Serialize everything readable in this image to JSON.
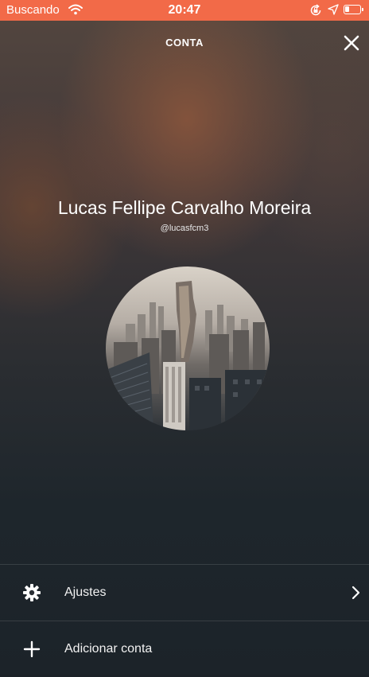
{
  "status_bar": {
    "carrier": "Buscando",
    "time": "20:47",
    "background_color": "#f26a48",
    "icons": [
      "wifi-icon",
      "rotation-lock-icon",
      "location-arrow-icon",
      "battery-icon"
    ]
  },
  "header": {
    "title": "CONTA",
    "close_icon": "close-icon"
  },
  "profile": {
    "name": "Lucas Fellipe Carvalho Moreira",
    "handle": "@lucasfcm3",
    "avatar_description_icon": "city-skyline-photo"
  },
  "menu": {
    "items": [
      {
        "label": "Ajustes",
        "icon": "gear-icon",
        "has_chevron": true
      },
      {
        "label": "Adicionar conta",
        "icon": "plus-icon",
        "has_chevron": false
      }
    ]
  }
}
